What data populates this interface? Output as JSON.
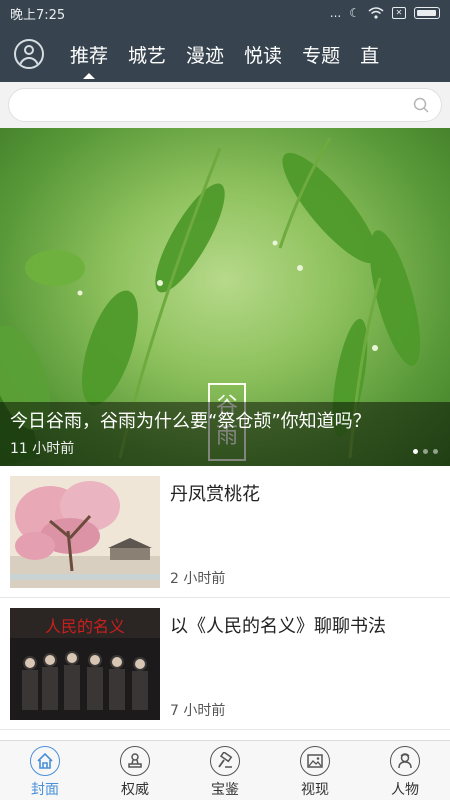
{
  "status_bar": {
    "time": "晚上7:25",
    "dots": "...",
    "sim": "✕"
  },
  "top_nav": {
    "tabs": [
      {
        "label": "推荐",
        "active": true
      },
      {
        "label": "城艺"
      },
      {
        "label": "漫迹"
      },
      {
        "label": "悦读"
      },
      {
        "label": "专题"
      },
      {
        "label": "直"
      }
    ]
  },
  "search": {
    "value": "",
    "placeholder": ""
  },
  "hero": {
    "stamp_line1": "谷",
    "stamp_line2": "雨",
    "title": "今日谷雨，谷雨为什么要“祭仓颉”你知道吗？",
    "time": "11 小时前"
  },
  "articles": [
    {
      "title": "丹凤赏桃花",
      "time": "2 小时前"
    },
    {
      "title": "以《人民的名义》聊聊书法",
      "time": "7 小时前",
      "thumb_text": "人民的名义"
    }
  ],
  "bottom_nav": {
    "items": [
      {
        "label": "封面",
        "icon": "home-icon",
        "active": true
      },
      {
        "label": "权威",
        "icon": "seal-icon"
      },
      {
        "label": "宝鉴",
        "icon": "gavel-icon"
      },
      {
        "label": "视现",
        "icon": "picture-icon"
      },
      {
        "label": "人物",
        "icon": "person-icon"
      }
    ]
  },
  "colors": {
    "header_bg": "#37444f",
    "accent": "#4a90d9"
  }
}
